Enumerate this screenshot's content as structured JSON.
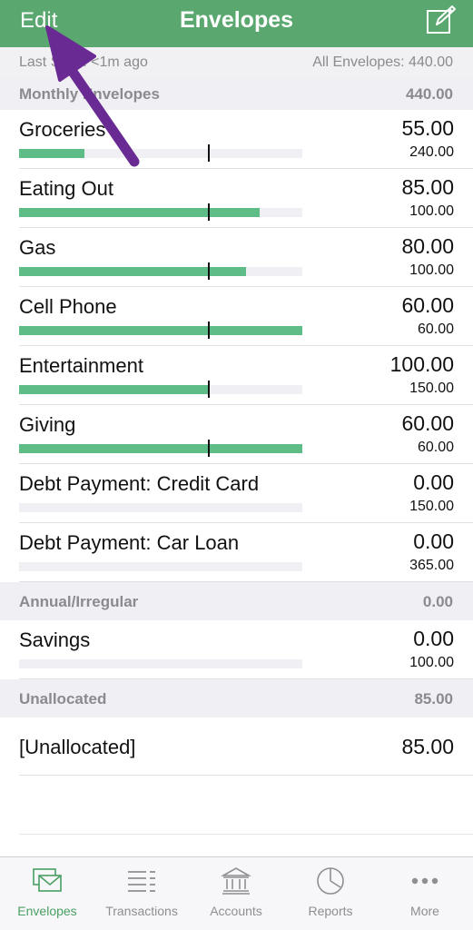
{
  "navbar": {
    "edit_label": "Edit",
    "title": "Envelopes",
    "compose_icon": "compose-icon"
  },
  "status": {
    "last_sync": "Last Sync: <1m ago",
    "all_envelopes": "All Envelopes: 440.00"
  },
  "sections": {
    "monthly": {
      "name": "Monthly Envelopes",
      "amount": "440.00"
    },
    "annual": {
      "name": "Annual/Irregular",
      "amount": "0.00"
    },
    "unallocated": {
      "name": "Unallocated",
      "amount": "85.00"
    }
  },
  "envelopes": [
    {
      "name": "Groceries",
      "amount": "55.00",
      "budget": "240.00",
      "progress": 0.23,
      "period_marker": 0.67
    },
    {
      "name": "Eating Out",
      "amount": "85.00",
      "budget": "100.00",
      "progress": 0.85,
      "period_marker": 0.67
    },
    {
      "name": "Gas",
      "amount": "80.00",
      "budget": "100.00",
      "progress": 0.8,
      "period_marker": 0.67
    },
    {
      "name": "Cell Phone",
      "amount": "60.00",
      "budget": "60.00",
      "progress": 1.0,
      "period_marker": 0.67
    },
    {
      "name": "Entertainment",
      "amount": "100.00",
      "budget": "150.00",
      "progress": 0.67,
      "period_marker": 0.67
    },
    {
      "name": "Giving",
      "amount": "60.00",
      "budget": "60.00",
      "progress": 1.0,
      "period_marker": 0.67
    },
    {
      "name": "Debt Payment: Credit Card",
      "amount": "0.00",
      "budget": "150.00",
      "progress": 0,
      "period_marker": null
    },
    {
      "name": "Debt Payment: Car Loan",
      "amount": "0.00",
      "budget": "365.00",
      "progress": 0,
      "period_marker": null
    }
  ],
  "annual_envelopes": [
    {
      "name": "Savings",
      "amount": "0.00",
      "budget": "100.00",
      "progress": 0,
      "period_marker": null
    }
  ],
  "unallocated_row": {
    "name": "[Unallocated]",
    "amount": "85.00"
  },
  "tabs": [
    {
      "label": "Envelopes",
      "icon": "envelopes-icon",
      "active": true
    },
    {
      "label": "Transactions",
      "icon": "list-icon",
      "active": false
    },
    {
      "label": "Accounts",
      "icon": "bank-icon",
      "active": false
    },
    {
      "label": "Reports",
      "icon": "pie-chart-icon",
      "active": false
    },
    {
      "label": "More",
      "icon": "more-dots-icon",
      "active": false
    }
  ],
  "colors": {
    "brand_green": "#5aa86f",
    "bar_green": "#5ebd86",
    "tab_active": "#4a9f63",
    "annotation_arrow": "#6a2a93"
  }
}
